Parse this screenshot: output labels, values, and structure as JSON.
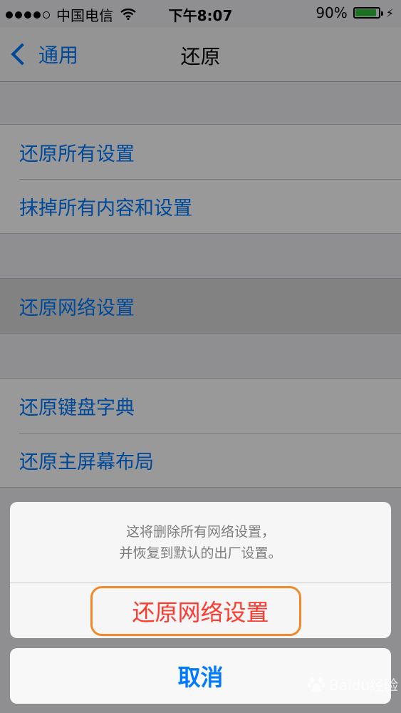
{
  "status_bar": {
    "carrier": "中国电信",
    "time": "下午8:07",
    "battery_percent": "90%",
    "battery_level": 0.9,
    "signal_bars": 4,
    "signal_total": 5
  },
  "nav": {
    "back_label": "通用",
    "title": "还原"
  },
  "list": {
    "group1": [
      "还原所有设置",
      "抹掉所有内容和设置"
    ],
    "group2": [
      "还原网络设置"
    ],
    "group3": [
      "还原键盘字典",
      "还原主屏幕布局"
    ]
  },
  "action_sheet": {
    "message_line1": "这将删除所有网络设置，",
    "message_line2": "并恢复到默认的出厂设置。",
    "destructive_label": "还原网络设置",
    "cancel_label": "取消"
  },
  "watermark": {
    "text": "Baidu经验"
  },
  "colors": {
    "accent": "#007aff",
    "destructive": "#ff3b30",
    "highlight": "#f08a2c",
    "battery": "#2fbd3a"
  }
}
